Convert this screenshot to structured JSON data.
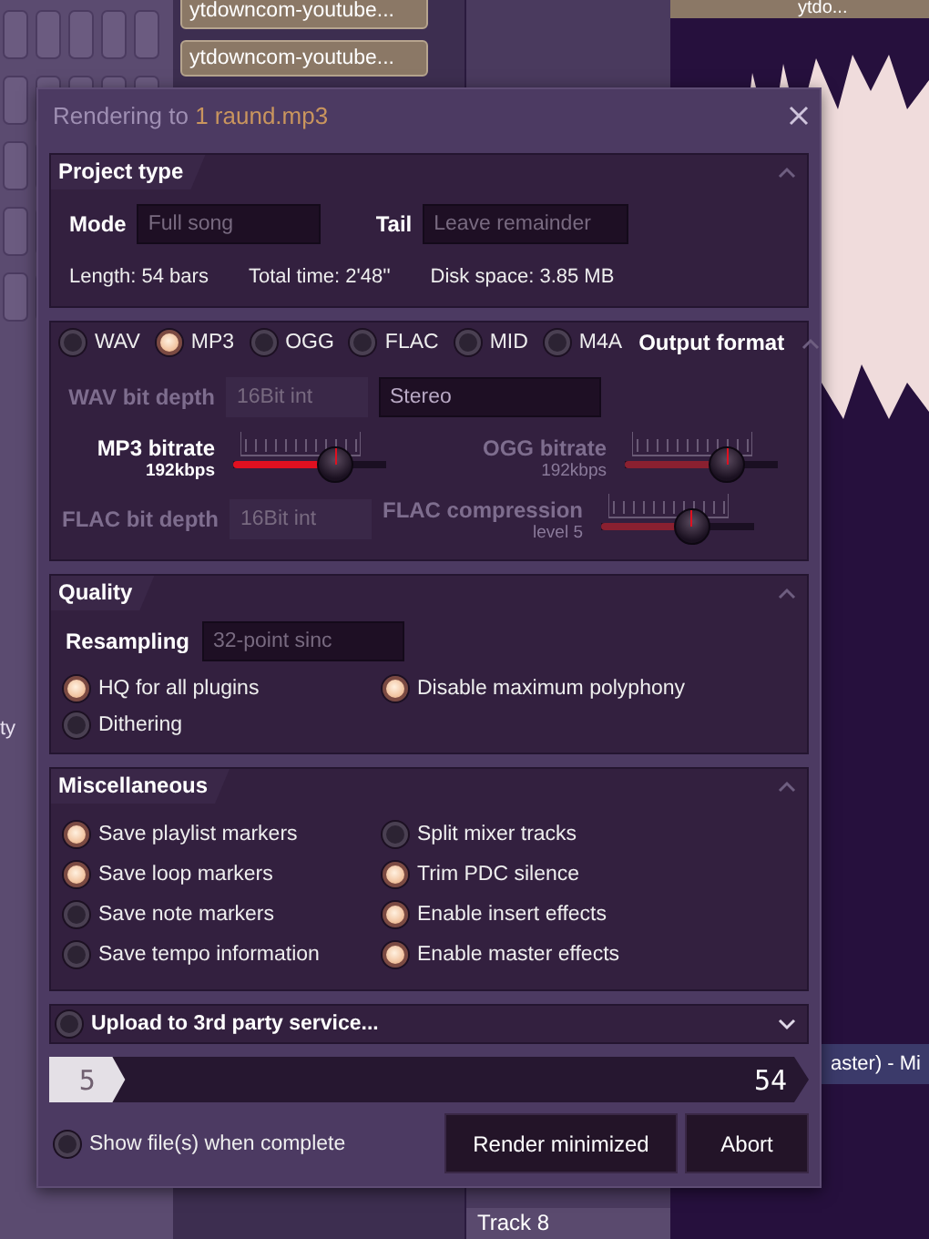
{
  "background": {
    "clips": [
      "ytdowncom-youtube...",
      "ytdowncom-youtube..."
    ],
    "side_label": "ty",
    "playlist_clip": "ytdo...",
    "mixer_label": "aster) - Mi",
    "track": "Track 8"
  },
  "dialog": {
    "title_prefix": "Rendering to",
    "title_file": "1 raund.mp3",
    "project_type": {
      "title": "Project type",
      "expanded": true,
      "mode": {
        "label": "Mode",
        "value": "Full song"
      },
      "tail": {
        "label": "Tail",
        "value": "Leave remainder"
      },
      "stats": [
        "Length: 54 bars",
        "Total time: 2'48''",
        "Disk space: 3.85 MB"
      ]
    },
    "output": {
      "title": "Output format",
      "expanded": true,
      "formats": [
        {
          "label": "WAV",
          "selected": false
        },
        {
          "label": "MP3",
          "selected": true
        },
        {
          "label": "OGG",
          "selected": false
        },
        {
          "label": "FLAC",
          "selected": false
        },
        {
          "label": "MID",
          "selected": false
        },
        {
          "label": "M4A",
          "selected": false
        }
      ],
      "wav_bit_depth": {
        "label": "WAV bit depth",
        "value": "16Bit int",
        "disabled": true
      },
      "channels": {
        "value": "Stereo"
      },
      "flac_bit_depth": {
        "label": "FLAC bit depth",
        "value": "16Bit int",
        "disabled": true
      },
      "sliders": [
        {
          "label": "MP3 bitrate",
          "reading": "192kbps",
          "level": 0.72,
          "disabled": false
        },
        {
          "label": "OGG bitrate",
          "reading": "192kbps",
          "level": 0.72,
          "disabled": true
        },
        {
          "label": "FLAC compression",
          "reading": "level 5",
          "level": 0.62,
          "disabled": true
        }
      ]
    },
    "quality": {
      "title": "Quality",
      "expanded": true,
      "resampling": {
        "label": "Resampling",
        "value": "32-point sinc"
      },
      "options": [
        {
          "label": "HQ for all plugins",
          "checked": true
        },
        {
          "label": "Disable maximum polyphony",
          "checked": true
        },
        {
          "label": "Dithering",
          "checked": false
        }
      ]
    },
    "misc": {
      "title": "Miscellaneous",
      "expanded": true,
      "left": [
        {
          "label": "Save playlist markers",
          "checked": true
        },
        {
          "label": "Save loop markers",
          "checked": true
        },
        {
          "label": "Save note markers",
          "checked": false
        },
        {
          "label": "Save tempo information",
          "checked": false
        }
      ],
      "right": [
        {
          "label": "Split mixer tracks",
          "checked": false
        },
        {
          "label": "Trim PDC silence",
          "checked": true
        },
        {
          "label": "Enable insert effects",
          "checked": true
        },
        {
          "label": "Enable master effects",
          "checked": true
        }
      ]
    },
    "upload": {
      "label": "Upload to 3rd party service...",
      "checked": false,
      "expanded": false
    },
    "progress": {
      "start": "5",
      "end": "54",
      "level": 0.1
    },
    "show_files": {
      "label": "Show file(s) when complete",
      "checked": false
    },
    "buttons": [
      "Render minimized",
      "Abort"
    ]
  }
}
